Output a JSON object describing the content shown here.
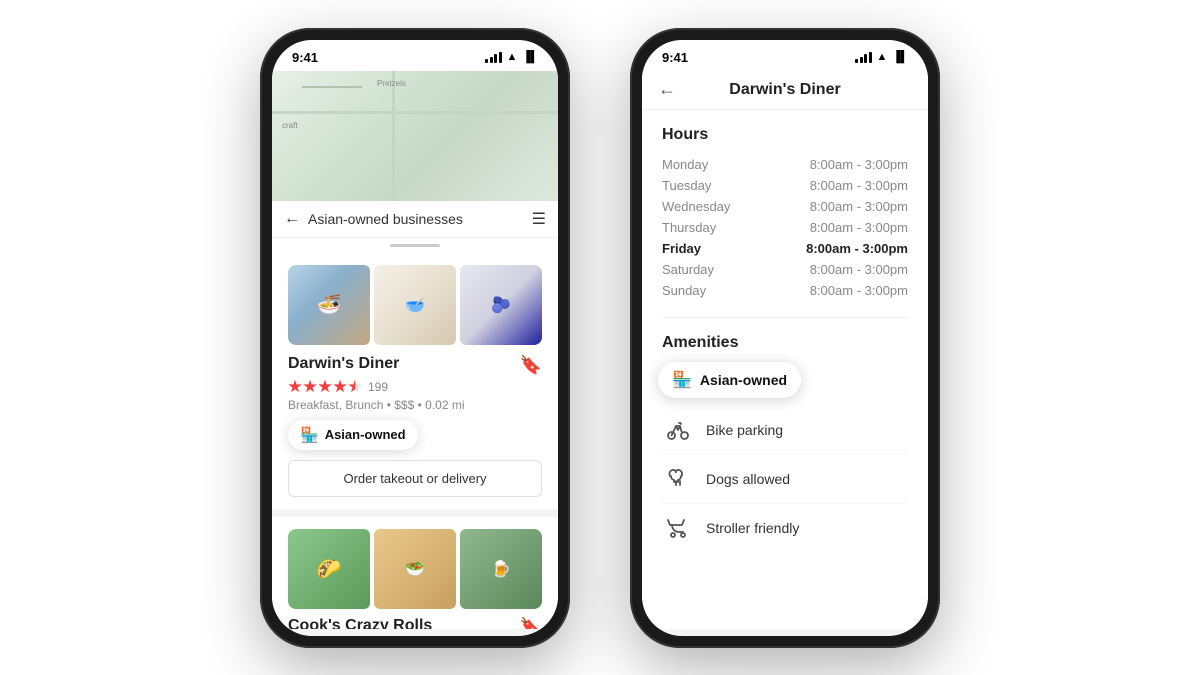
{
  "phone1": {
    "time": "9:41",
    "map": {
      "label": "craft"
    },
    "search": {
      "placeholder": "Asian-owned businesses",
      "value": "Asian-owned businesses"
    },
    "restaurant1": {
      "name": "Darwin's Diner",
      "rating": 4.5,
      "review_count": "199",
      "meta": "Breakfast, Brunch • $$$ • 0.02 mi",
      "badge": "Asian-owned",
      "order_btn": "Order takeout or delivery"
    },
    "restaurant2": {
      "name": "Cook's Crazy Rolls"
    }
  },
  "phone2": {
    "time": "9:41",
    "header": {
      "title": "Darwin's Diner",
      "back_label": "←"
    },
    "hours": {
      "section_title": "Hours",
      "days": [
        {
          "day": "Monday",
          "hours": "8:00am - 3:00pm",
          "bold": false
        },
        {
          "day": "Tuesday",
          "hours": "8:00am - 3:00pm",
          "bold": false
        },
        {
          "day": "Wednesday",
          "hours": "8:00am - 3:00pm",
          "bold": false
        },
        {
          "day": "Thursday",
          "hours": "8:00am - 3:00pm",
          "bold": false
        },
        {
          "day": "Friday",
          "hours": "8:00am - 3:00pm",
          "bold": true
        },
        {
          "day": "Saturday",
          "hours": "8:00am - 3:00pm",
          "bold": false
        },
        {
          "day": "Sunday",
          "hours": "8:00am - 3:00pm",
          "bold": false
        }
      ]
    },
    "amenities": {
      "section_title": "Amenities",
      "badge": "Asian-owned",
      "items": [
        {
          "label": "Bike parking",
          "icon": "bike"
        },
        {
          "label": "Dogs allowed",
          "icon": "dog"
        },
        {
          "label": "Stroller friendly",
          "icon": "stroller"
        }
      ]
    }
  }
}
